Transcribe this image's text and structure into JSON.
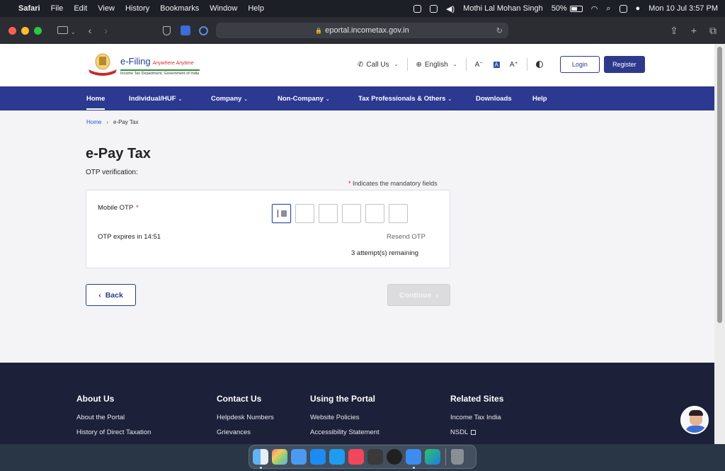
{
  "menubar": {
    "apple": "",
    "items": [
      "Safari",
      "File",
      "Edit",
      "View",
      "History",
      "Bookmarks",
      "Window",
      "Help"
    ],
    "user": "Mothi Lal Mohan Singh",
    "battery": "50%",
    "clock": "Mon 10 Jul  3:57 PM"
  },
  "browser": {
    "url": "eportal.incometax.gov.in",
    "lock": "🔒"
  },
  "header": {
    "brand_name": "e-Filing",
    "brand_tag": "Anywhere Anytime",
    "brand_dept": "Income Tax Department, Government of India",
    "call_us": "Call Us",
    "language": "English",
    "font_decrease": "A⁻",
    "font_normal": "A",
    "font_increase": "A⁺",
    "login": "Login",
    "register": "Register"
  },
  "nav": {
    "home": "Home",
    "individual": "Individual/HUF",
    "company": "Company",
    "non_company": "Non-Company",
    "tax_professionals": "Tax Professionals & Others",
    "downloads": "Downloads",
    "help": "Help"
  },
  "breadcrumb": {
    "home": "Home",
    "separator": "›",
    "current": "e-Pay Tax"
  },
  "main": {
    "title": "e-Pay Tax",
    "subtitle": "OTP verification:",
    "mandatory_star": "*",
    "mandatory_text": " Indicates the mandatory fields",
    "otp_label": "Mobile OTP",
    "otp_star": "*",
    "otp_expires": "OTP expires in 14:51",
    "resend": "Resend OTP",
    "attempts": "3 attempt(s) remaining",
    "back": "Back",
    "continue": "Continue"
  },
  "footer": {
    "about": {
      "heading": "About Us",
      "links": [
        "About the Portal",
        "History of Direct Taxation"
      ]
    },
    "contact": {
      "heading": "Contact Us",
      "links": [
        "Helpdesk Numbers",
        "Grievances"
      ]
    },
    "portal": {
      "heading": "Using the Portal",
      "links": [
        "Website Policies",
        "Accessibility Statement"
      ]
    },
    "related": {
      "heading": "Related Sites",
      "links": [
        "Income Tax India",
        "NSDL"
      ]
    }
  },
  "colors": {
    "nav_bg": "#2b3990",
    "footer_bg": "#1d2039",
    "primary_button": "#2d3a8c",
    "mandatory_star": "#d01b1b"
  }
}
